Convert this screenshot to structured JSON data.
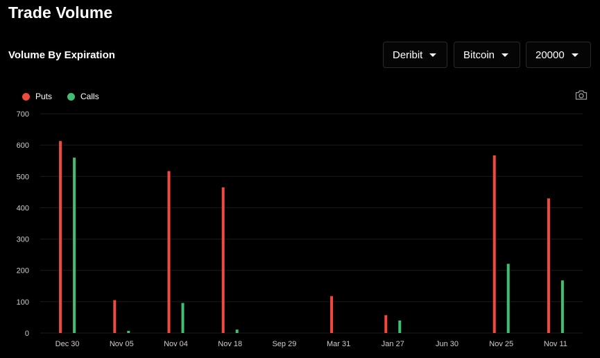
{
  "header": {
    "title": "Trade Volume"
  },
  "section": {
    "title": "Volume By Expiration"
  },
  "filters": {
    "exchange": "Deribit",
    "asset": "Bitcoin",
    "strike": "20000"
  },
  "icons": {
    "dropdown": "caret-down-icon",
    "export": "camera-icon"
  },
  "colors": {
    "puts": "#f0493f",
    "calls": "#3fbf6f",
    "background": "#000000",
    "grid": "#1c1c1c"
  },
  "chart_data": {
    "type": "bar",
    "title": "",
    "xlabel": "",
    "ylabel": "",
    "categories": [
      "Dec 30",
      "Nov 05",
      "Nov 04",
      "Nov 18",
      "Sep 29",
      "Mar 31",
      "Jan 27",
      "Jun 30",
      "Nov 25",
      "Nov 11"
    ],
    "series": [
      {
        "name": "Puts",
        "color": "#f0493f",
        "values": [
          613,
          105,
          517,
          465,
          0,
          118,
          57,
          0,
          567,
          430
        ]
      },
      {
        "name": "Calls",
        "color": "#3fbf6f",
        "values": [
          560,
          7,
          96,
          11,
          0,
          0,
          40,
          0,
          221,
          168
        ]
      }
    ],
    "ylim": [
      0,
      700
    ],
    "yticks": [
      0,
      100,
      200,
      300,
      400,
      500,
      600,
      700
    ],
    "grid": true,
    "legend": "top-left"
  }
}
